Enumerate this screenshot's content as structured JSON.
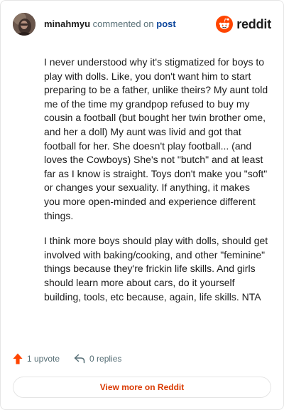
{
  "header": {
    "username": "minahmyu",
    "action_text": "commented on",
    "post_link": "post",
    "logo_text": "reddit"
  },
  "comment": {
    "paragraphs": [
      "I never understood why it's stigmatized for boys to play with dolls. Like, you don't want him to start preparing to be a father, unlike theirs? My aunt told me of the time my grandpop refused to buy my cousin a football (but bought her twin brother ome, and her a doll) My aunt was livid and got that football for her. She doesn't play football... (and loves the Cowboys) She's not \"butch\" and at least far as I know is straight. Toys don't make you \"soft\" or changes your sexuality. If anything, it makes you more open-minded and experience different things.",
      "I think more boys should play with dolls, should get involved with baking/cooking, and other \"feminine\" things because they're frickin life skills. And girls should learn more about cars, do it yourself building, tools, etc because, again, life skills. NTA"
    ]
  },
  "actions": {
    "upvote_label": "1 upvote",
    "replies_label": "0 replies"
  },
  "footer": {
    "view_more_label": "View more on Reddit"
  },
  "colors": {
    "brand": "#ff4500",
    "link": "#0a449b",
    "view_more": "#d93900",
    "meta": "#576f76"
  },
  "icons": {
    "avatar": "user-avatar",
    "logo": "reddit-snoo-icon",
    "upvote": "upvote-arrow-icon",
    "reply": "reply-arrow-icon"
  }
}
